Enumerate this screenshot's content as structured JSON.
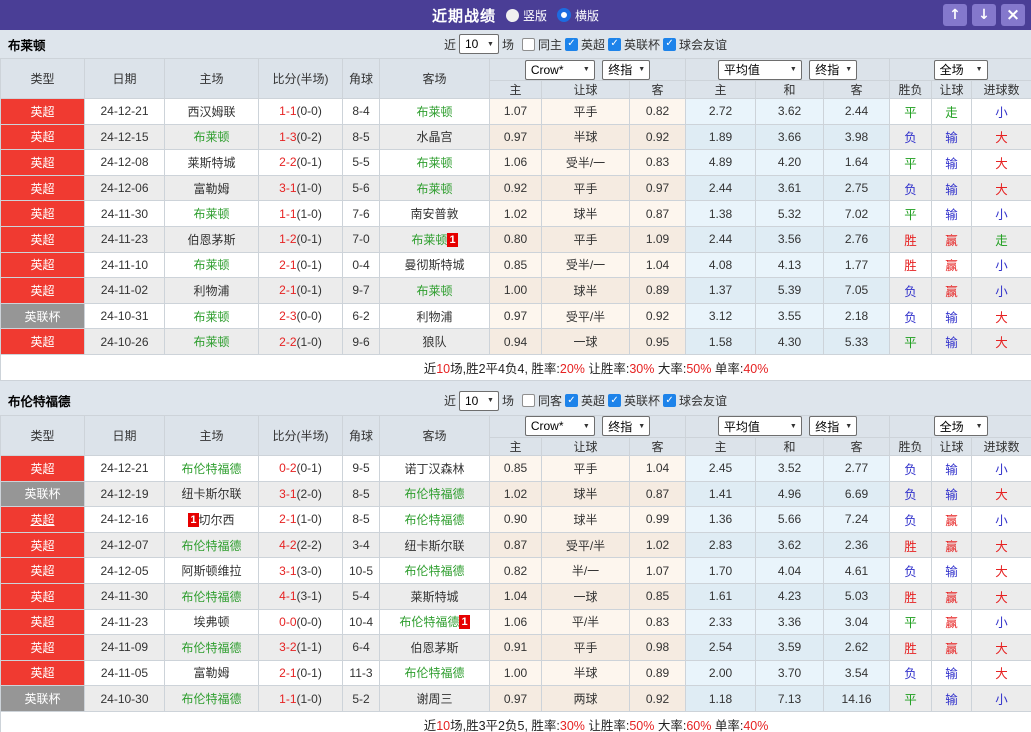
{
  "header": {
    "title": "近期战绩",
    "radio_vertical": "竖版",
    "radio_horizontal": "横版"
  },
  "icons": {
    "up": "↑",
    "down": "↓",
    "close": "×",
    "check": "✓",
    "caret": "▼"
  },
  "colors": {
    "topbar_purple": "#4a3e96",
    "type_red": "#f03a31",
    "type_gray": "#969696",
    "team_green": "#2e9e2e",
    "result_red": "#e62222",
    "result_blue": "#3333cc",
    "result_green": "#1e9e1e",
    "checkbox_blue": "#1d83ea",
    "page_bg": "#dee5ec"
  },
  "labels": {
    "type": "类型",
    "date": "日期",
    "home": "主场",
    "score": "比分(半场)",
    "corner": "角球",
    "away": "客场",
    "crow": "Crow*",
    "final": "终指",
    "avg": "平均值",
    "full": "全场",
    "odds_home": "主",
    "odds_handicap": "让球",
    "odds_away": "客",
    "avg_home": "主",
    "avg_draw": "和",
    "avg_away": "客",
    "result_wl": "胜负",
    "result_handicap": "让球",
    "result_goals": "进球数",
    "near": "近",
    "matches": "场"
  },
  "sections": [
    {
      "team": "布莱顿",
      "filters": {
        "count": "10",
        "same": "同主",
        "leagues": [
          "英超",
          "英联杯",
          "球会友谊"
        ]
      },
      "rows": [
        {
          "type": "英超",
          "tc": "red",
          "u": false,
          "date": "24-12-21",
          "home": {
            "t": "西汉姆联",
            "g": false,
            "b": "",
            "bp": ""
          },
          "ft": "1-1",
          "ht": "(0-0)",
          "cor": "8-4",
          "away": {
            "t": "布莱顿",
            "g": true,
            "b": "",
            "bp": ""
          },
          "odds": [
            "1.07",
            "平手",
            "0.82"
          ],
          "avg": [
            "2.72",
            "3.62",
            "2.44"
          ],
          "res": [
            [
              "平",
              "g"
            ],
            [
              "走",
              "g"
            ],
            [
              "小",
              "b"
            ]
          ]
        },
        {
          "type": "英超",
          "tc": "red",
          "u": false,
          "date": "24-12-15",
          "home": {
            "t": "布莱顿",
            "g": true,
            "b": "",
            "bp": ""
          },
          "ft": "1-3",
          "ht": "(0-2)",
          "cor": "8-5",
          "away": {
            "t": "水晶宫",
            "g": false,
            "b": "",
            "bp": ""
          },
          "odds": [
            "0.97",
            "半球",
            "0.92"
          ],
          "avg": [
            "1.89",
            "3.66",
            "3.98"
          ],
          "res": [
            [
              "负",
              "b"
            ],
            [
              "输",
              "b"
            ],
            [
              "大",
              "r"
            ]
          ]
        },
        {
          "type": "英超",
          "tc": "red",
          "u": false,
          "date": "24-12-08",
          "home": {
            "t": "莱斯特城",
            "g": false,
            "b": "",
            "bp": ""
          },
          "ft": "2-2",
          "ht": "(0-1)",
          "cor": "5-5",
          "away": {
            "t": "布莱顿",
            "g": true,
            "b": "",
            "bp": ""
          },
          "odds": [
            "1.06",
            "受半/一",
            "0.83"
          ],
          "avg": [
            "4.89",
            "4.20",
            "1.64"
          ],
          "res": [
            [
              "平",
              "g"
            ],
            [
              "输",
              "b"
            ],
            [
              "大",
              "r"
            ]
          ]
        },
        {
          "type": "英超",
          "tc": "red",
          "u": false,
          "date": "24-12-06",
          "home": {
            "t": "富勒姆",
            "g": false,
            "b": "",
            "bp": ""
          },
          "ft": "3-1",
          "ht": "(1-0)",
          "cor": "5-6",
          "away": {
            "t": "布莱顿",
            "g": true,
            "b": "",
            "bp": ""
          },
          "odds": [
            "0.92",
            "平手",
            "0.97"
          ],
          "avg": [
            "2.44",
            "3.61",
            "2.75"
          ],
          "res": [
            [
              "负",
              "b"
            ],
            [
              "输",
              "b"
            ],
            [
              "大",
              "r"
            ]
          ]
        },
        {
          "type": "英超",
          "tc": "red",
          "u": false,
          "date": "24-11-30",
          "home": {
            "t": "布莱顿",
            "g": true,
            "b": "",
            "bp": ""
          },
          "ft": "1-1",
          "ht": "(1-0)",
          "cor": "7-6",
          "away": {
            "t": "南安普敦",
            "g": false,
            "b": "",
            "bp": ""
          },
          "odds": [
            "1.02",
            "球半",
            "0.87"
          ],
          "avg": [
            "1.38",
            "5.32",
            "7.02"
          ],
          "res": [
            [
              "平",
              "g"
            ],
            [
              "输",
              "b"
            ],
            [
              "小",
              "b"
            ]
          ]
        },
        {
          "type": "英超",
          "tc": "red",
          "u": false,
          "date": "24-11-23",
          "home": {
            "t": "伯恩茅斯",
            "g": false,
            "b": "",
            "bp": ""
          },
          "ft": "1-2",
          "ht": "(0-1)",
          "cor": "7-0",
          "away": {
            "t": "布莱顿",
            "g": true,
            "b": "1",
            "bp": "after"
          },
          "odds": [
            "0.80",
            "平手",
            "1.09"
          ],
          "avg": [
            "2.44",
            "3.56",
            "2.76"
          ],
          "res": [
            [
              "胜",
              "r"
            ],
            [
              "赢",
              "r"
            ],
            [
              "走",
              "g"
            ]
          ]
        },
        {
          "type": "英超",
          "tc": "red",
          "u": false,
          "date": "24-11-10",
          "home": {
            "t": "布莱顿",
            "g": true,
            "b": "",
            "bp": ""
          },
          "ft": "2-1",
          "ht": "(0-1)",
          "cor": "0-4",
          "away": {
            "t": "曼彻斯特城",
            "g": false,
            "b": "",
            "bp": ""
          },
          "odds": [
            "0.85",
            "受半/一",
            "1.04"
          ],
          "avg": [
            "4.08",
            "4.13",
            "1.77"
          ],
          "res": [
            [
              "胜",
              "r"
            ],
            [
              "赢",
              "r"
            ],
            [
              "小",
              "b"
            ]
          ]
        },
        {
          "type": "英超",
          "tc": "red",
          "u": false,
          "date": "24-11-02",
          "home": {
            "t": "利物浦",
            "g": false,
            "b": "",
            "bp": ""
          },
          "ft": "2-1",
          "ht": "(0-1)",
          "cor": "9-7",
          "away": {
            "t": "布莱顿",
            "g": true,
            "b": "",
            "bp": ""
          },
          "odds": [
            "1.00",
            "球半",
            "0.89"
          ],
          "avg": [
            "1.37",
            "5.39",
            "7.05"
          ],
          "res": [
            [
              "负",
              "b"
            ],
            [
              "赢",
              "r"
            ],
            [
              "小",
              "b"
            ]
          ]
        },
        {
          "type": "英联杯",
          "tc": "gray",
          "u": false,
          "date": "24-10-31",
          "home": {
            "t": "布莱顿",
            "g": true,
            "b": "",
            "bp": ""
          },
          "ft": "2-3",
          "ht": "(0-0)",
          "cor": "6-2",
          "away": {
            "t": "利物浦",
            "g": false,
            "b": "",
            "bp": ""
          },
          "odds": [
            "0.97",
            "受平/半",
            "0.92"
          ],
          "avg": [
            "3.12",
            "3.55",
            "2.18"
          ],
          "res": [
            [
              "负",
              "b"
            ],
            [
              "输",
              "b"
            ],
            [
              "大",
              "r"
            ]
          ]
        },
        {
          "type": "英超",
          "tc": "red",
          "u": false,
          "date": "24-10-26",
          "home": {
            "t": "布莱顿",
            "g": true,
            "b": "",
            "bp": ""
          },
          "ft": "2-2",
          "ht": "(1-0)",
          "cor": "9-6",
          "away": {
            "t": "狼队",
            "g": false,
            "b": "",
            "bp": ""
          },
          "odds": [
            "0.94",
            "一球",
            "0.95"
          ],
          "avg": [
            "1.58",
            "4.30",
            "5.33"
          ],
          "res": [
            [
              "平",
              "g"
            ],
            [
              "输",
              "b"
            ],
            [
              "大",
              "r"
            ]
          ]
        }
      ],
      "summary": [
        {
          "t": "近"
        },
        {
          "t": "10",
          "r": 1
        },
        {
          "t": "场,胜2平4负4, 胜率:"
        },
        {
          "t": "20%",
          "r": 1
        },
        {
          "t": " 让胜率:"
        },
        {
          "t": "30%",
          "r": 1
        },
        {
          "t": " 大率:"
        },
        {
          "t": "50%",
          "r": 1
        },
        {
          "t": " 单率:"
        },
        {
          "t": "40%",
          "r": 1
        }
      ]
    },
    {
      "team": "布伦特福德",
      "filters": {
        "count": "10",
        "same": "同客",
        "leagues": [
          "英超",
          "英联杯",
          "球会友谊"
        ]
      },
      "rows": [
        {
          "type": "英超",
          "tc": "red",
          "u": false,
          "date": "24-12-21",
          "home": {
            "t": "布伦特福德",
            "g": true,
            "b": "",
            "bp": ""
          },
          "ft": "0-2",
          "ht": "(0-1)",
          "cor": "9-5",
          "away": {
            "t": "诺丁汉森林",
            "g": false,
            "b": "",
            "bp": ""
          },
          "odds": [
            "0.85",
            "平手",
            "1.04"
          ],
          "avg": [
            "2.45",
            "3.52",
            "2.77"
          ],
          "res": [
            [
              "负",
              "b"
            ],
            [
              "输",
              "b"
            ],
            [
              "小",
              "b"
            ]
          ]
        },
        {
          "type": "英联杯",
          "tc": "gray",
          "u": false,
          "date": "24-12-19",
          "home": {
            "t": "纽卡斯尔联",
            "g": false,
            "b": "",
            "bp": ""
          },
          "ft": "3-1",
          "ht": "(2-0)",
          "cor": "8-5",
          "away": {
            "t": "布伦特福德",
            "g": true,
            "b": "",
            "bp": ""
          },
          "odds": [
            "1.02",
            "球半",
            "0.87"
          ],
          "avg": [
            "1.41",
            "4.96",
            "6.69"
          ],
          "res": [
            [
              "负",
              "b"
            ],
            [
              "输",
              "b"
            ],
            [
              "大",
              "r"
            ]
          ]
        },
        {
          "type": "英超",
          "tc": "red",
          "u": true,
          "date": "24-12-16",
          "home": {
            "t": "切尔西",
            "g": false,
            "b": "1",
            "bp": "before"
          },
          "ft": "2-1",
          "ht": "(1-0)",
          "cor": "8-5",
          "away": {
            "t": "布伦特福德",
            "g": true,
            "b": "",
            "bp": ""
          },
          "odds": [
            "0.90",
            "球半",
            "0.99"
          ],
          "avg": [
            "1.36",
            "5.66",
            "7.24"
          ],
          "res": [
            [
              "负",
              "b"
            ],
            [
              "赢",
              "r"
            ],
            [
              "小",
              "b"
            ]
          ]
        },
        {
          "type": "英超",
          "tc": "red",
          "u": false,
          "date": "24-12-07",
          "home": {
            "t": "布伦特福德",
            "g": true,
            "b": "",
            "bp": ""
          },
          "ft": "4-2",
          "ht": "(2-2)",
          "cor": "3-4",
          "away": {
            "t": "纽卡斯尔联",
            "g": false,
            "b": "",
            "bp": ""
          },
          "odds": [
            "0.87",
            "受平/半",
            "1.02"
          ],
          "avg": [
            "2.83",
            "3.62",
            "2.36"
          ],
          "res": [
            [
              "胜",
              "r"
            ],
            [
              "赢",
              "r"
            ],
            [
              "大",
              "r"
            ]
          ]
        },
        {
          "type": "英超",
          "tc": "red",
          "u": false,
          "date": "24-12-05",
          "home": {
            "t": "阿斯顿维拉",
            "g": false,
            "b": "",
            "bp": ""
          },
          "ft": "3-1",
          "ht": "(3-0)",
          "cor": "10-5",
          "away": {
            "t": "布伦特福德",
            "g": true,
            "b": "",
            "bp": ""
          },
          "odds": [
            "0.82",
            "半/一",
            "1.07"
          ],
          "avg": [
            "1.70",
            "4.04",
            "4.61"
          ],
          "res": [
            [
              "负",
              "b"
            ],
            [
              "输",
              "b"
            ],
            [
              "大",
              "r"
            ]
          ]
        },
        {
          "type": "英超",
          "tc": "red",
          "u": false,
          "date": "24-11-30",
          "home": {
            "t": "布伦特福德",
            "g": true,
            "b": "",
            "bp": ""
          },
          "ft": "4-1",
          "ht": "(3-1)",
          "cor": "5-4",
          "away": {
            "t": "莱斯特城",
            "g": false,
            "b": "",
            "bp": ""
          },
          "odds": [
            "1.04",
            "一球",
            "0.85"
          ],
          "avg": [
            "1.61",
            "4.23",
            "5.03"
          ],
          "res": [
            [
              "胜",
              "r"
            ],
            [
              "赢",
              "r"
            ],
            [
              "大",
              "r"
            ]
          ]
        },
        {
          "type": "英超",
          "tc": "red",
          "u": false,
          "date": "24-11-23",
          "home": {
            "t": "埃弗顿",
            "g": false,
            "b": "",
            "bp": ""
          },
          "ft": "0-0",
          "ht": "(0-0)",
          "cor": "10-4",
          "away": {
            "t": "布伦特福德",
            "g": true,
            "b": "1",
            "bp": "after"
          },
          "odds": [
            "1.06",
            "平/半",
            "0.83"
          ],
          "avg": [
            "2.33",
            "3.36",
            "3.04"
          ],
          "res": [
            [
              "平",
              "g"
            ],
            [
              "赢",
              "r"
            ],
            [
              "小",
              "b"
            ]
          ]
        },
        {
          "type": "英超",
          "tc": "red",
          "u": false,
          "date": "24-11-09",
          "home": {
            "t": "布伦特福德",
            "g": true,
            "b": "",
            "bp": ""
          },
          "ft": "3-2",
          "ht": "(1-1)",
          "cor": "6-4",
          "away": {
            "t": "伯恩茅斯",
            "g": false,
            "b": "",
            "bp": ""
          },
          "odds": [
            "0.91",
            "平手",
            "0.98"
          ],
          "avg": [
            "2.54",
            "3.59",
            "2.62"
          ],
          "res": [
            [
              "胜",
              "r"
            ],
            [
              "赢",
              "r"
            ],
            [
              "大",
              "r"
            ]
          ]
        },
        {
          "type": "英超",
          "tc": "red",
          "u": false,
          "date": "24-11-05",
          "home": {
            "t": "富勒姆",
            "g": false,
            "b": "",
            "bp": ""
          },
          "ft": "2-1",
          "ht": "(0-1)",
          "cor": "11-3",
          "away": {
            "t": "布伦特福德",
            "g": true,
            "b": "",
            "bp": ""
          },
          "odds": [
            "1.00",
            "半球",
            "0.89"
          ],
          "avg": [
            "2.00",
            "3.70",
            "3.54"
          ],
          "res": [
            [
              "负",
              "b"
            ],
            [
              "输",
              "b"
            ],
            [
              "大",
              "r"
            ]
          ]
        },
        {
          "type": "英联杯",
          "tc": "gray",
          "u": false,
          "date": "24-10-30",
          "home": {
            "t": "布伦特福德",
            "g": true,
            "b": "",
            "bp": ""
          },
          "ft": "1-1",
          "ht": "(1-0)",
          "cor": "5-2",
          "away": {
            "t": "谢周三",
            "g": false,
            "b": "",
            "bp": ""
          },
          "odds": [
            "0.97",
            "两球",
            "0.92"
          ],
          "avg": [
            "1.18",
            "7.13",
            "14.16"
          ],
          "res": [
            [
              "平",
              "g"
            ],
            [
              "输",
              "b"
            ],
            [
              "小",
              "b"
            ]
          ]
        }
      ],
      "summary": [
        {
          "t": "近"
        },
        {
          "t": "10",
          "r": 1
        },
        {
          "t": "场,胜3平2负5, 胜率:"
        },
        {
          "t": "30%",
          "r": 1
        },
        {
          "t": " 让胜率:"
        },
        {
          "t": "50%",
          "r": 1
        },
        {
          "t": " 大率:"
        },
        {
          "t": "60%",
          "r": 1
        },
        {
          "t": " 单率:"
        },
        {
          "t": "40%",
          "r": 1
        }
      ]
    }
  ]
}
